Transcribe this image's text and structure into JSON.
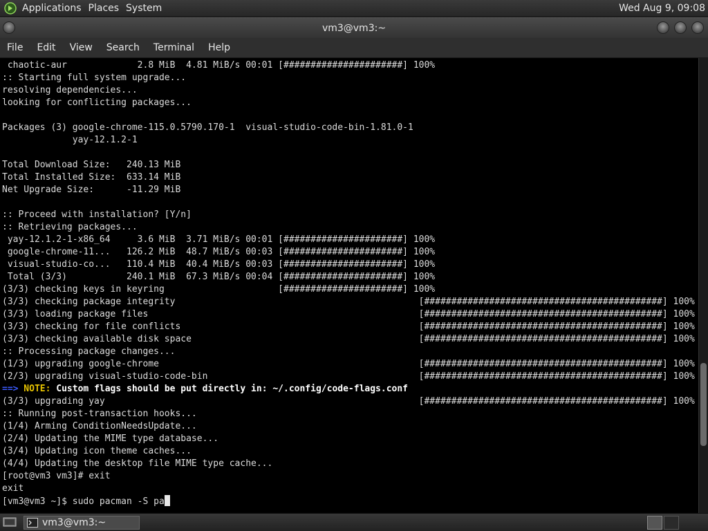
{
  "top_panel": {
    "menus": [
      "Applications",
      "Places",
      "System"
    ],
    "clock": "Wed Aug  9, 09:08",
    "logo_icon": "gnome-foot-icon"
  },
  "window": {
    "title": "vm3@vm3:~",
    "menubar": [
      "File",
      "Edit",
      "View",
      "Search",
      "Terminal",
      "Help"
    ]
  },
  "terminal": {
    "lines": [
      " chaotic-aur             2.8 MiB  4.81 MiB/s 00:01 [######################] 100%",
      ":: Starting full system upgrade...",
      "resolving dependencies...",
      "looking for conflicting packages...",
      "",
      "Packages (3) google-chrome-115.0.5790.170-1  visual-studio-code-bin-1.81.0-1",
      "             yay-12.1.2-1",
      "",
      "Total Download Size:   240.13 MiB",
      "Total Installed Size:  633.14 MiB",
      "Net Upgrade Size:      -11.29 MiB",
      "",
      ":: Proceed with installation? [Y/n]",
      ":: Retrieving packages...",
      " yay-12.1.2-1-x86_64     3.6 MiB  3.71 MiB/s 00:01 [######################] 100%",
      " google-chrome-11...   126.2 MiB  48.7 MiB/s 00:03 [######################] 100%",
      " visual-studio-co...   110.4 MiB  40.4 MiB/s 00:03 [######################] 100%",
      " Total (3/3)           240.1 MiB  67.3 MiB/s 00:04 [######################] 100%",
      "(3/3) checking keys in keyring                     [######################] 100%",
      "(3/3) checking package integrity                                             [############################################] 100%",
      "(3/3) loading package files                                                  [############################################] 100%",
      "(3/3) checking for file conflicts                                            [############################################] 100%",
      "(3/3) checking available disk space                                          [############################################] 100%",
      ":: Processing package changes...",
      "(1/3) upgrading google-chrome                                                [############################################] 100%",
      "(2/3) upgrading visual-studio-code-bin                                       [############################################] 100%",
      "",
      "(3/3) upgrading yay                                                          [############################################] 100%",
      ":: Running post-transaction hooks...",
      "(1/4) Arming ConditionNeedsUpdate...",
      "(2/4) Updating the MIME type database...",
      "(3/4) Updating icon theme caches...",
      "(4/4) Updating the desktop file MIME type cache...",
      "[root@vm3 vm3]# exit",
      "exit",
      ""
    ],
    "note": {
      "arrow": "==>",
      "label": " NOTE:",
      "text": " Custom flags should be put directly in: ~/.config/code-flags.conf"
    },
    "prompt": "[vm3@vm3 ~]$ sudo pacman -S pa",
    "scroll_position": 0.82
  },
  "taskbar": {
    "task_label": "vm3@vm3:~",
    "task_icon": "terminal-icon",
    "show_desktop_icon": "show-desktop-icon"
  },
  "colors": {
    "note_arrow": "#3b5bff",
    "note_label": "#e6c200",
    "terminal_bg": "#000000",
    "terminal_fg": "#dcdcdc"
  }
}
